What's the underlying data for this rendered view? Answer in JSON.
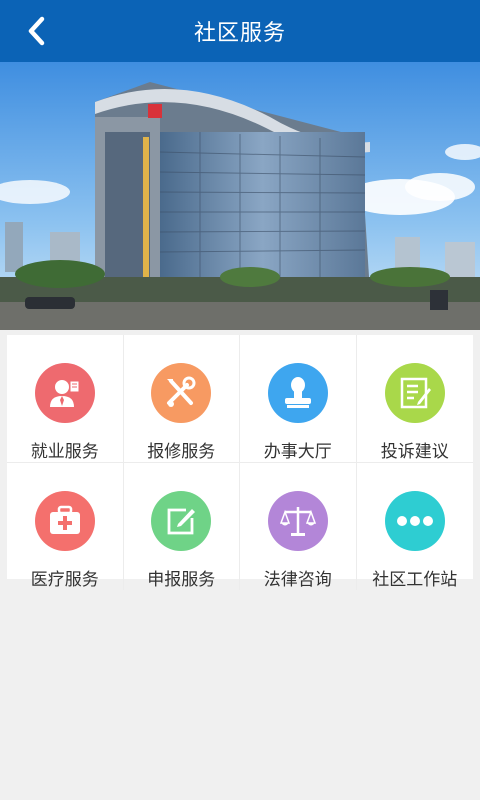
{
  "header": {
    "title": "社区服务",
    "back_icon": "chevron-left-icon",
    "background": "#0b63b6"
  },
  "banner": {
    "description_icon": "building-photo"
  },
  "services": [
    {
      "label": "就业服务",
      "icon": "employment-icon",
      "color": "#ee6a6f"
    },
    {
      "label": "报修服务",
      "icon": "repair-tools-icon",
      "color": "#f79a62"
    },
    {
      "label": "办事大厅",
      "icon": "stamp-icon",
      "color": "#3ea6ef"
    },
    {
      "label": "投诉建议",
      "icon": "document-edit-icon",
      "color": "#a9d84a"
    },
    {
      "label": "医疗服务",
      "icon": "medical-kit-icon",
      "color": "#f4706d"
    },
    {
      "label": "申报服务",
      "icon": "edit-square-icon",
      "color": "#6fd387"
    },
    {
      "label": "法律咨询",
      "icon": "scales-icon",
      "color": "#b386d8"
    },
    {
      "label": "社区工作站",
      "icon": "more-dots-icon",
      "color": "#2ecdd2"
    }
  ]
}
